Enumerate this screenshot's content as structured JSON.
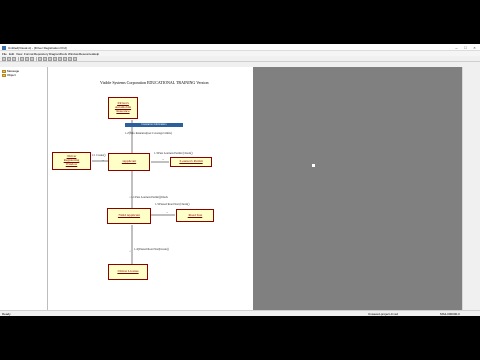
{
  "window": {
    "title": "Untitled(Visual.vi) - [Driver Registration Pcd]",
    "minimize": "–",
    "maximize": "□",
    "close": "×"
  },
  "menu": [
    "File",
    "Edit",
    "View",
    "Format",
    "Repository",
    "Diagram",
    "Tools",
    "Window",
    "Resources",
    "Help"
  ],
  "tree": {
    "items": [
      "Message",
      "Object"
    ]
  },
  "diagram": {
    "page_title": "Visible Systems Corporation EDUCATIONAL TRAINING Version",
    "objects": {
      "automobile_insurance": ":Driver's\nAutomobile\nInsurance",
      "registering_window": ":Driver\nRegistering\nWindow",
      "applicant": ":Applicant",
      "learners_permit": ":Learner's Permit",
      "valid_applicant": ":Valid Applicant",
      "road_test": ":Road Test",
      "drivers_license": ":Driver License"
    },
    "tag_bar": "Insurance Information",
    "messages": {
      "m_create": "1:1 Create()",
      "m_insurance": "1.2:[Info Insurance(Get Coverage Limits)",
      "m_permit": "1.3:Pass Learners Permit (Check()",
      "m_valid": "1.1:Pass Learners Permit()Check",
      "m_roadtest": "1.3:Passed Road Test (Check()",
      "m_license": "1.4:[Passed Road Test]Create()"
    }
  },
  "status": {
    "left": "Ready",
    "document": "Unsaved-project-0.vsd",
    "number": "MS4-000000-0"
  },
  "colors": {
    "object_fill": "#ffffc8",
    "object_border": "#8b0000",
    "tag_bar": "#2c5f9e",
    "workspace_gray": "#808080"
  }
}
